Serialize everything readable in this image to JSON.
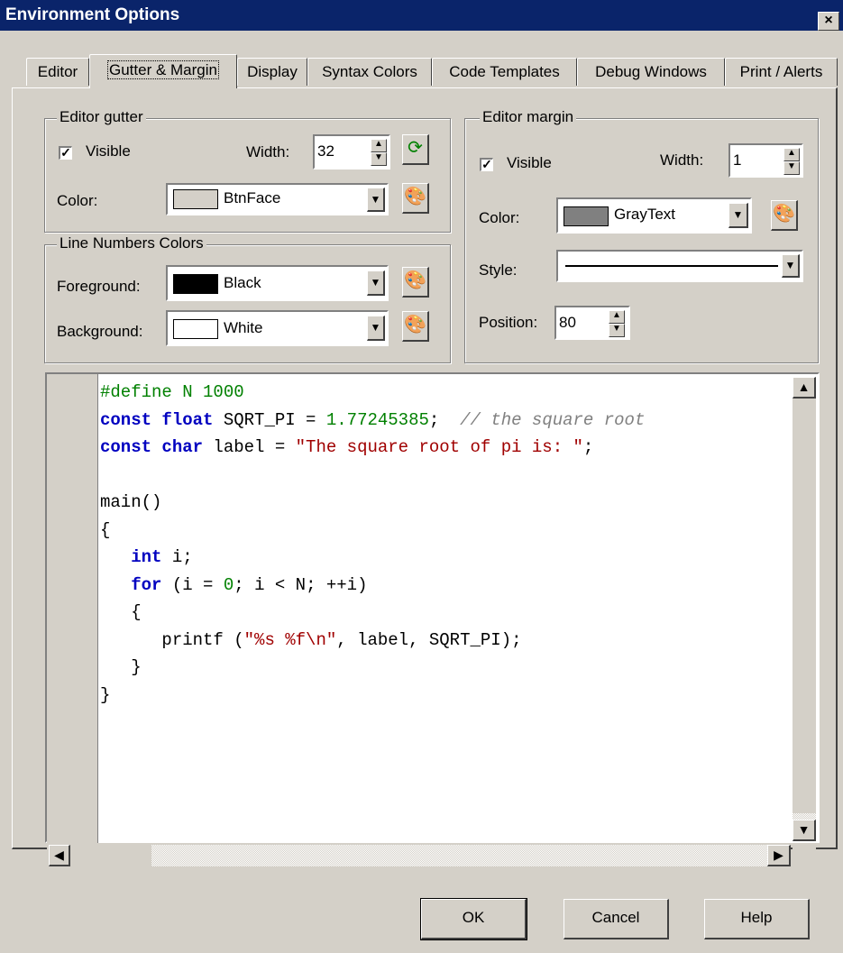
{
  "window": {
    "title": "Environment Options",
    "close_label": "×"
  },
  "tabs": [
    {
      "label": "Editor"
    },
    {
      "label": "Gutter & Margin",
      "active": true
    },
    {
      "label": "Display"
    },
    {
      "label": "Syntax Colors"
    },
    {
      "label": "Code Templates"
    },
    {
      "label": "Debug Windows"
    },
    {
      "label": "Print / Alerts"
    }
  ],
  "gutter": {
    "group_label": "Editor gutter",
    "visible_label": "Visible",
    "visible_checked": true,
    "width_label": "Width:",
    "width_value": "32",
    "color_label": "Color:",
    "color_value": "BtnFace",
    "color_swatch": "#d4d0c8"
  },
  "line_numbers": {
    "group_label": "Line Numbers Colors",
    "foreground_label": "Foreground:",
    "foreground_value": "Black",
    "foreground_swatch": "#000000",
    "background_label": "Background:",
    "background_value": "White",
    "background_swatch": "#ffffff"
  },
  "margin": {
    "group_label": "Editor margin",
    "visible_label": "Visible",
    "visible_checked": true,
    "width_label": "Width:",
    "width_value": "1",
    "color_label": "Color:",
    "color_value": "GrayText",
    "color_swatch": "#808080",
    "style_label": "Style:",
    "position_label": "Position:",
    "position_value": "80"
  },
  "preview": {
    "lines": [
      [
        {
          "t": "#define N 1000",
          "c": "pp"
        }
      ],
      [
        {
          "t": "const",
          "c": "kw"
        },
        {
          "t": " "
        },
        {
          "t": "float",
          "c": "kw"
        },
        {
          "t": " SQRT_PI = "
        },
        {
          "t": "1.77245385",
          "c": "num"
        },
        {
          "t": ";  "
        },
        {
          "t": "// the square root",
          "c": "cmt"
        }
      ],
      [
        {
          "t": "const",
          "c": "kw"
        },
        {
          "t": " "
        },
        {
          "t": "char",
          "c": "kw"
        },
        {
          "t": " label = "
        },
        {
          "t": "\"The square root of pi is: \"",
          "c": "str"
        },
        {
          "t": ";"
        }
      ],
      [
        {
          "t": ""
        }
      ],
      [
        {
          "t": "main()"
        }
      ],
      [
        {
          "t": "{"
        }
      ],
      [
        {
          "t": "   "
        },
        {
          "t": "int",
          "c": "kw"
        },
        {
          "t": " i;"
        }
      ],
      [
        {
          "t": "   "
        },
        {
          "t": "for",
          "c": "kw"
        },
        {
          "t": " (i = "
        },
        {
          "t": "0",
          "c": "num"
        },
        {
          "t": "; i < N; ++i)"
        }
      ],
      [
        {
          "t": "   {"
        }
      ],
      [
        {
          "t": "      printf ("
        },
        {
          "t": "\"%s %f\\n\"",
          "c": "str"
        },
        {
          "t": ", label, SQRT_PI);"
        }
      ],
      [
        {
          "t": "   }"
        }
      ],
      [
        {
          "t": "}"
        }
      ]
    ]
  },
  "buttons": {
    "ok": "OK",
    "cancel": "Cancel",
    "help": "Help"
  }
}
